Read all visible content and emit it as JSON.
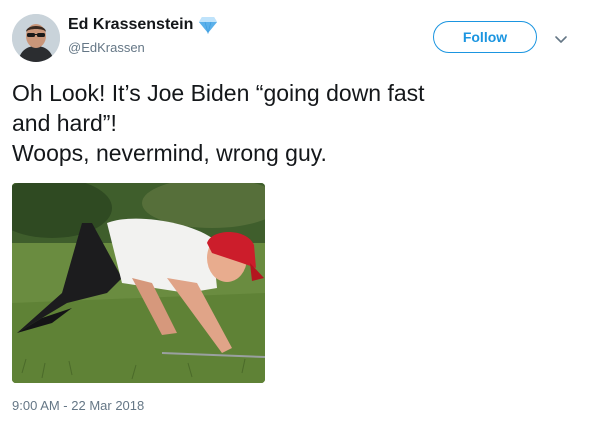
{
  "author": {
    "display_name": "Ed Krassenstein",
    "handle": "@EdKrassen",
    "verified_icon": "verified-diamond-icon",
    "avatar_icon": "profile-photo"
  },
  "actions": {
    "follow_label": "Follow",
    "more_icon": "chevron-down-icon"
  },
  "tweet": {
    "lines": [
      "Oh Look!  It’s Joe Biden “going down fast",
      "and hard”!",
      "Woops, nevermind, wrong guy."
    ],
    "timestamp": "9:00 AM - 22 Mar 2018"
  },
  "media": {
    "icon": "photo-man-crawling-on-grass"
  },
  "colors": {
    "accent": "#1b95e0",
    "text": "#14171a",
    "secondary": "#657786"
  }
}
